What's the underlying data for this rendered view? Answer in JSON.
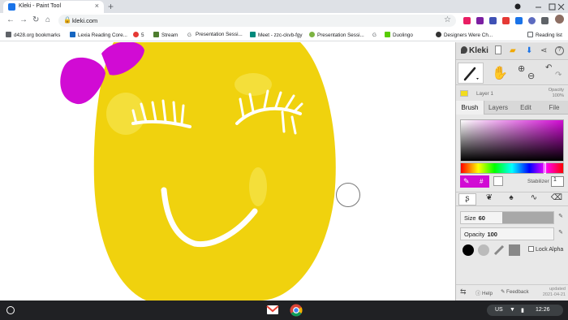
{
  "browser": {
    "tab": {
      "title": "Kleki - Paint Tool",
      "close_glyph": "×"
    },
    "new_tab_glyph": "+",
    "address": {
      "url": "kleki.com"
    },
    "nav": {
      "back": "←",
      "forward": "→",
      "reload": "↻",
      "home": "⌂"
    },
    "bookmarks": [
      {
        "label": "d428.org bookmarks",
        "color": "#5f6368"
      },
      {
        "label": "Lexia Reading Core...",
        "color": "#1565c0"
      },
      {
        "label": "5",
        "color": "#e53935"
      },
      {
        "label": "Stream",
        "color": "#4e7d2f"
      },
      {
        "label": "Presentation Sessi...",
        "color": "#5f6368"
      },
      {
        "label": "Meet - zzc-ckvb-fgy",
        "color": "#00897b"
      },
      {
        "label": "Presentation Sessi...",
        "color": "#7cb342"
      },
      {
        "label": "",
        "color": "#5f6368"
      },
      {
        "label": "Duolingo",
        "color": "#58cc02"
      },
      {
        "label": "Designers Were Ch...",
        "color": "#333333"
      }
    ],
    "reading_list": "Reading list"
  },
  "kleki": {
    "logo": "Kleki",
    "layer": {
      "name": "Layer 1",
      "opacity_label": "Opacity",
      "opacity_value": "100%"
    },
    "tabs": [
      "Brush",
      "Layers",
      "Edit",
      "File"
    ],
    "active_tab": "Brush",
    "color": {
      "primary": "#d10bd4",
      "secondary": "#ffffff",
      "picker_hex_glyph": "#"
    },
    "stabilizer": {
      "label": "Stabilizer",
      "value": "1"
    },
    "size": {
      "label": "Size",
      "value": "60",
      "fraction": 0.45
    },
    "opacity": {
      "label": "Opacity",
      "value": "100",
      "fraction": 1.0
    },
    "lock_alpha": "Lock Alpha",
    "footer": {
      "help": "Help",
      "feedback": "Feedback",
      "updated_label": "updated",
      "updated_date": "2021-04-21"
    }
  },
  "shelf": {
    "locale": "US",
    "time": "12:26"
  }
}
